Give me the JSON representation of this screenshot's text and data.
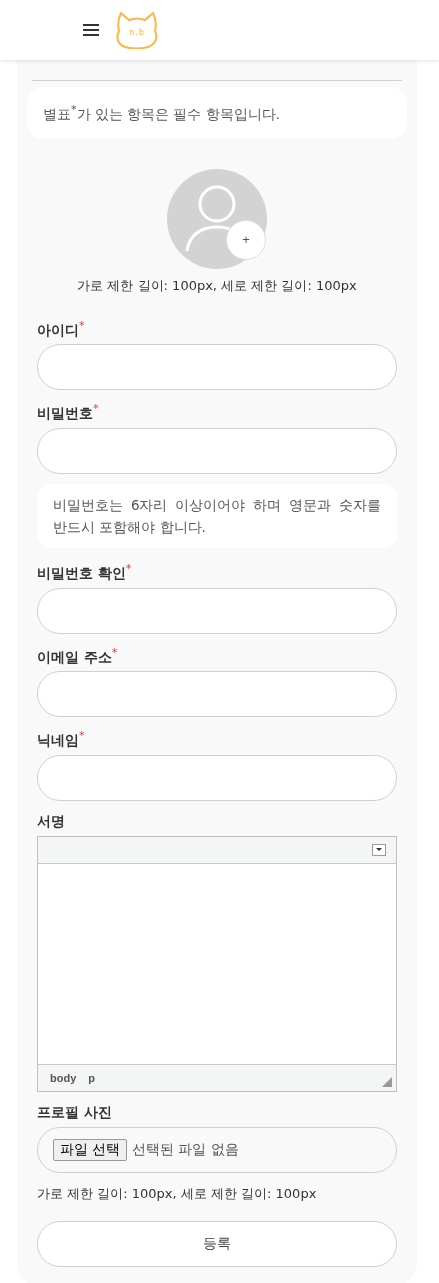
{
  "header": {
    "logo_text": "n.b"
  },
  "notice": {
    "before": "별표",
    "mark": "*",
    "after": "가 있는 항목은 필수 항목입니다."
  },
  "avatar": {
    "add_label": "+",
    "caption": "가로 제한 길이: 100px, 세로 제한 길이: 100px"
  },
  "fields": [
    {
      "kind": "input",
      "label": "아이디",
      "required": true
    },
    {
      "kind": "input",
      "label": "비밀번호",
      "required": true
    },
    {
      "kind": "notice",
      "text": "비밀번호는 6자리 이상이어야 하며 영문과 숫자를 반드시 포함해야 합니다."
    },
    {
      "kind": "input",
      "label": "비밀번호 확인",
      "required": true
    },
    {
      "kind": "input",
      "label": "이메일 주소",
      "required": true
    },
    {
      "kind": "input",
      "label": "닉네임",
      "required": true
    },
    {
      "kind": "editor",
      "label": "서명",
      "required": false,
      "path": [
        "body",
        "p"
      ]
    },
    {
      "kind": "file",
      "label": "프로필 사진",
      "required": false,
      "button": "파일 선택",
      "status": "선택된 파일 없음",
      "caption": "가로 제한 길이: 100px, 세로 제한 길이: 100px"
    }
  ],
  "submit": "등록"
}
